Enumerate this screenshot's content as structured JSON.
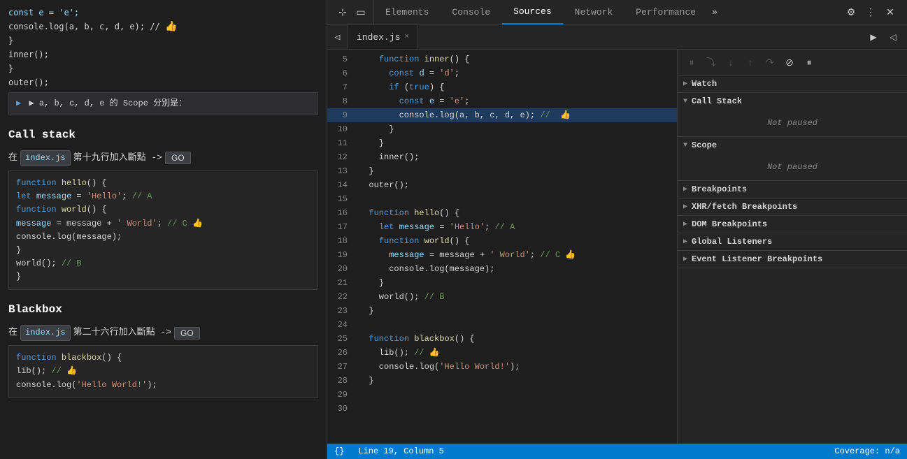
{
  "leftPanel": {
    "topCode": [
      "    const e = 'e';",
      "    console.log(a, b, c, d, e); // 👍",
      "  }",
      "  inner();",
      "}",
      "outer();"
    ],
    "scopeLabel": "▶ a, b, c, d, e 的 Scope 分別是：",
    "callStackTitle": "Call stack",
    "callStackLine1": "在",
    "callStackFile1": "index.js",
    "callStackLine1Text": "第十九行加入斷點 ->",
    "callStackGo1": "GO",
    "callStackCode": [
      "function hello() {",
      "  let message = 'Hello'; // A",
      "  function world() {",
      "    message = message + ' World'; // C 👍",
      "    console.log(message);",
      "  }",
      "  world(); // B",
      "}"
    ],
    "blackboxTitle": "Blackbox",
    "blackboxLine1": "在",
    "blackboxFile1": "index.js",
    "blackboxLine1Text": "第二十六行加入斷點 ->",
    "blackboxGo1": "GO",
    "blackboxCode": [
      "function blackbox() {",
      "  lib(); // 👍",
      "  console.log('Hello World!');"
    ]
  },
  "devtools": {
    "tabs": [
      {
        "id": "elements",
        "label": "Elements",
        "active": false
      },
      {
        "id": "console",
        "label": "Console",
        "active": false
      },
      {
        "id": "sources",
        "label": "Sources",
        "active": true
      },
      {
        "id": "network",
        "label": "Network",
        "active": false
      },
      {
        "id": "performance",
        "label": "Performance",
        "active": false
      }
    ],
    "tabMore": "»",
    "settingsIcon": "⚙",
    "menuIcon": "⋮",
    "closeIcon": "✕"
  },
  "fileTab": {
    "name": "index.js",
    "closeIcon": "×"
  },
  "codeLines": [
    {
      "num": 5,
      "content": "    function inner() {",
      "highlight": false
    },
    {
      "num": 6,
      "content": "      const d = 'd';",
      "highlight": false
    },
    {
      "num": 7,
      "content": "      if (true) {",
      "highlight": false
    },
    {
      "num": 8,
      "content": "        const e = 'e';",
      "highlight": false
    },
    {
      "num": 9,
      "content": "        console.log(a, b, c, d, e); // 👍",
      "highlight": true
    },
    {
      "num": 10,
      "content": "      }",
      "highlight": false
    },
    {
      "num": 11,
      "content": "    }",
      "highlight": false
    },
    {
      "num": 12,
      "content": "    inner();",
      "highlight": false
    },
    {
      "num": 13,
      "content": "  }",
      "highlight": false
    },
    {
      "num": 14,
      "content": "  outer();",
      "highlight": false
    },
    {
      "num": 15,
      "content": "",
      "highlight": false
    },
    {
      "num": 16,
      "content": "  function hello() {",
      "highlight": false
    },
    {
      "num": 17,
      "content": "    let message = 'Hello'; // A",
      "highlight": false
    },
    {
      "num": 18,
      "content": "    function world() {",
      "highlight": false
    },
    {
      "num": 19,
      "content": "      message = message + ' World'; // C 👍",
      "highlight": false
    },
    {
      "num": 20,
      "content": "      console.log(message);",
      "highlight": false
    },
    {
      "num": 21,
      "content": "    }",
      "highlight": false
    },
    {
      "num": 22,
      "content": "    world(); // B",
      "highlight": false
    },
    {
      "num": 23,
      "content": "  }",
      "highlight": false
    },
    {
      "num": 24,
      "content": "",
      "highlight": false
    },
    {
      "num": 25,
      "content": "  function blackbox() {",
      "highlight": false
    },
    {
      "num": 26,
      "content": "    lib(); // 👍",
      "highlight": false
    },
    {
      "num": 27,
      "content": "    console.log('Hello World!');",
      "highlight": false
    },
    {
      "num": 28,
      "content": "  }",
      "highlight": false
    },
    {
      "num": 29,
      "content": "",
      "highlight": false
    },
    {
      "num": 30,
      "content": "",
      "highlight": false
    }
  ],
  "debuggerToolbar": {
    "pause": "⏸",
    "stepOver": "↷",
    "stepInto": "↓",
    "stepOut": "↑",
    "continue": "▶▶",
    "deactivate": "⊘",
    "pauseOnException": "⏸"
  },
  "rightSections": [
    {
      "id": "watch",
      "label": "Watch",
      "expanded": false,
      "arrow": "▶",
      "content": null
    },
    {
      "id": "callstack",
      "label": "Call Stack",
      "expanded": true,
      "arrow": "▼",
      "content": "Not paused"
    },
    {
      "id": "scope",
      "label": "Scope",
      "expanded": true,
      "arrow": "▼",
      "content": "Not paused"
    },
    {
      "id": "breakpoints",
      "label": "Breakpoints",
      "expanded": false,
      "arrow": "▶",
      "content": null
    },
    {
      "id": "xhr",
      "label": "XHR/fetch Breakpoints",
      "expanded": false,
      "arrow": "▶",
      "content": null
    },
    {
      "id": "dom",
      "label": "DOM Breakpoints",
      "expanded": false,
      "arrow": "▶",
      "content": null
    },
    {
      "id": "globalListeners",
      "label": "Global Listeners",
      "expanded": false,
      "arrow": "▶",
      "content": null
    },
    {
      "id": "eventListeners",
      "label": "Event Listener Breakpoints",
      "expanded": false,
      "arrow": "▶",
      "content": null
    }
  ],
  "statusBar": {
    "braces": "{}",
    "position": "Line 19, Column 5",
    "coverage": "Coverage: n/a"
  }
}
